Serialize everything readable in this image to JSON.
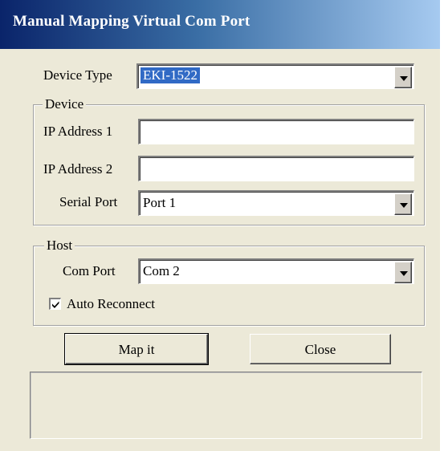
{
  "window": {
    "title": "Manual Mapping Virtual Com Port"
  },
  "device_type": {
    "label": "Device Type",
    "value": "EKI-1522"
  },
  "device_group": {
    "title": "Device",
    "ip1_label": "IP Address 1",
    "ip1_value": "",
    "ip2_label": "IP Address 2",
    "ip2_value": "",
    "serial_label": "Serial Port",
    "serial_value": "Port 1"
  },
  "host_group": {
    "title": "Host",
    "com_label": "Com Port",
    "com_value": "Com 2",
    "auto_reconnect_label": "Auto Reconnect",
    "auto_reconnect_checked": true
  },
  "buttons": {
    "map_label": "Map it",
    "close_label": "Close"
  },
  "status": {
    "text": ""
  },
  "colors": {
    "title_start": "#0a246a",
    "title_end": "#a6caf0",
    "face": "#ece9d8",
    "selection": "#316ac5"
  }
}
